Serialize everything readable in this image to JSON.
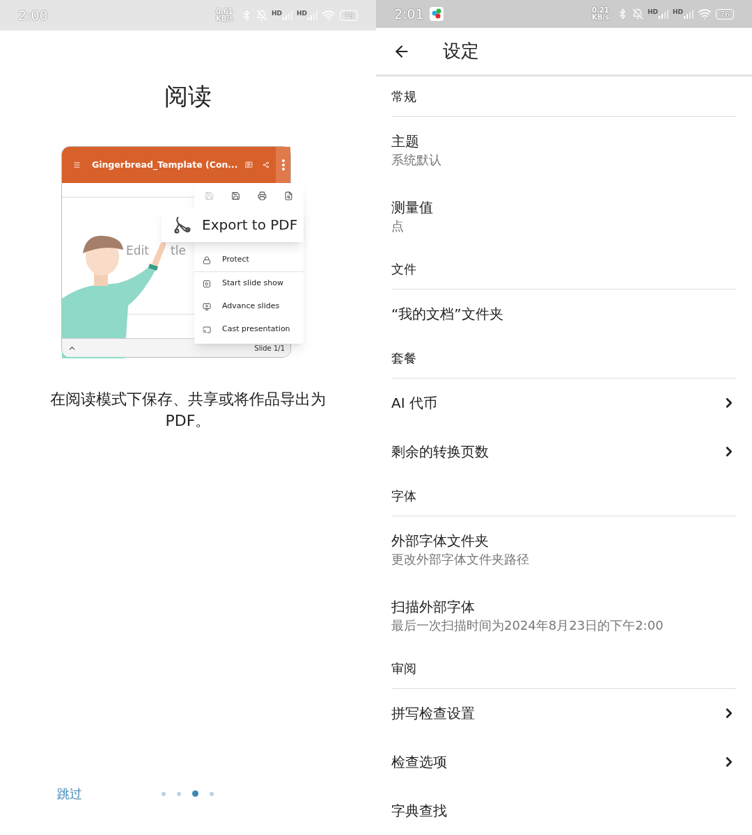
{
  "left": {
    "status_bar": {
      "time": "2:00",
      "speed": "0.61 KB/s",
      "hd": [
        "HD",
        "HD"
      ],
      "battery": "76"
    },
    "title": "阅读",
    "illustration": {
      "app_title": "Gingerbread_Template (Con...",
      "export_label": "Export to PDF",
      "slide_title": [
        "Edit",
        "tle"
      ],
      "menu_items": [
        {
          "kind": "protect",
          "label": "Protect"
        },
        {
          "kind": "slideshow",
          "label": "Start slide show"
        },
        {
          "kind": "advance",
          "label": "Advance slides"
        },
        {
          "kind": "cast",
          "label": "Cast presentation"
        }
      ],
      "slide_counter": "Slide 1/1"
    },
    "description": "在阅读模式下保存、共享或将作品导出为PDF。",
    "skip": "跳过",
    "page_dots": [
      {
        "selected": false
      },
      {
        "selected": false
      },
      {
        "selected": true
      },
      {
        "selected": false
      }
    ]
  },
  "right": {
    "status_bar": {
      "time": "2:01",
      "speed": "0.21 KB/s",
      "hd": [
        "HD",
        "HD"
      ],
      "battery": "76"
    },
    "header": {
      "title": "设定"
    },
    "sections": [
      {
        "title": "常规",
        "items": [
          {
            "title": "主题",
            "subtitle": "系统默认",
            "chevron": false
          },
          {
            "title": "测量值",
            "subtitle": "点",
            "chevron": false
          }
        ]
      },
      {
        "title": "文件",
        "items": [
          {
            "title": "“我的文档”文件夹",
            "chevron": false
          }
        ]
      },
      {
        "title": "套餐",
        "items": [
          {
            "title": "AI 代币",
            "chevron": true
          },
          {
            "title": "剩余的转换页数",
            "chevron": true
          }
        ]
      },
      {
        "title": "字体",
        "items": [
          {
            "title": "外部字体文件夹",
            "subtitle": "更改外部字体文件夹路径",
            "chevron": false
          },
          {
            "title": "扫描外部字体",
            "subtitle": "最后一次扫描时间为2024年8月23日的下午2:00",
            "chevron": false
          }
        ]
      },
      {
        "title": "审阅",
        "items": [
          {
            "title": "拼写检查设置",
            "chevron": true
          },
          {
            "title": "检查选项",
            "chevron": true
          },
          {
            "title": "字典查找",
            "chevron": false
          }
        ]
      }
    ]
  }
}
